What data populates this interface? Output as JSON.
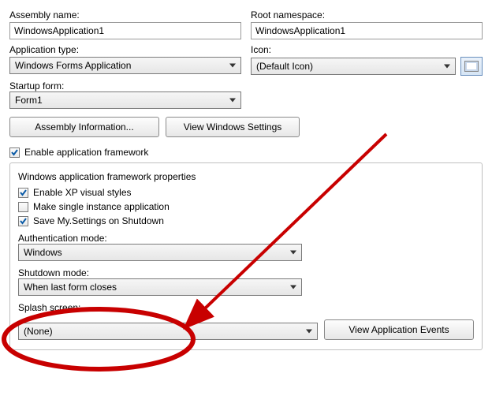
{
  "assembly": {
    "label": "Assembly name:",
    "value": "WindowsApplication1"
  },
  "rootns": {
    "label": "Root namespace:",
    "value": "WindowsApplication1"
  },
  "apptype": {
    "label": "Application type:",
    "value": "Windows Forms Application"
  },
  "icon": {
    "label": "Icon:",
    "value": "(Default Icon)"
  },
  "startup": {
    "label": "Startup form:",
    "value": "Form1"
  },
  "buttons": {
    "assembly_info": "Assembly Information...",
    "view_win_settings": "View Windows Settings",
    "view_app_events": "View Application Events"
  },
  "enable_framework": {
    "label": "Enable application framework",
    "checked": true
  },
  "section_title": "Windows application framework properties",
  "xp_styles": {
    "label": "Enable XP visual styles",
    "checked": true
  },
  "single_instance": {
    "label": "Make single instance application",
    "checked": false
  },
  "save_settings": {
    "label": "Save My.Settings on Shutdown",
    "checked": true
  },
  "auth_mode": {
    "label": "Authentication mode:",
    "value": "Windows"
  },
  "shutdown_mode": {
    "label": "Shutdown mode:",
    "value": "When last form closes"
  },
  "splash": {
    "label": "Splash screen:",
    "value": "(None)"
  },
  "colors": {
    "annotation": "#c80000",
    "check": "#0a5aa6"
  }
}
